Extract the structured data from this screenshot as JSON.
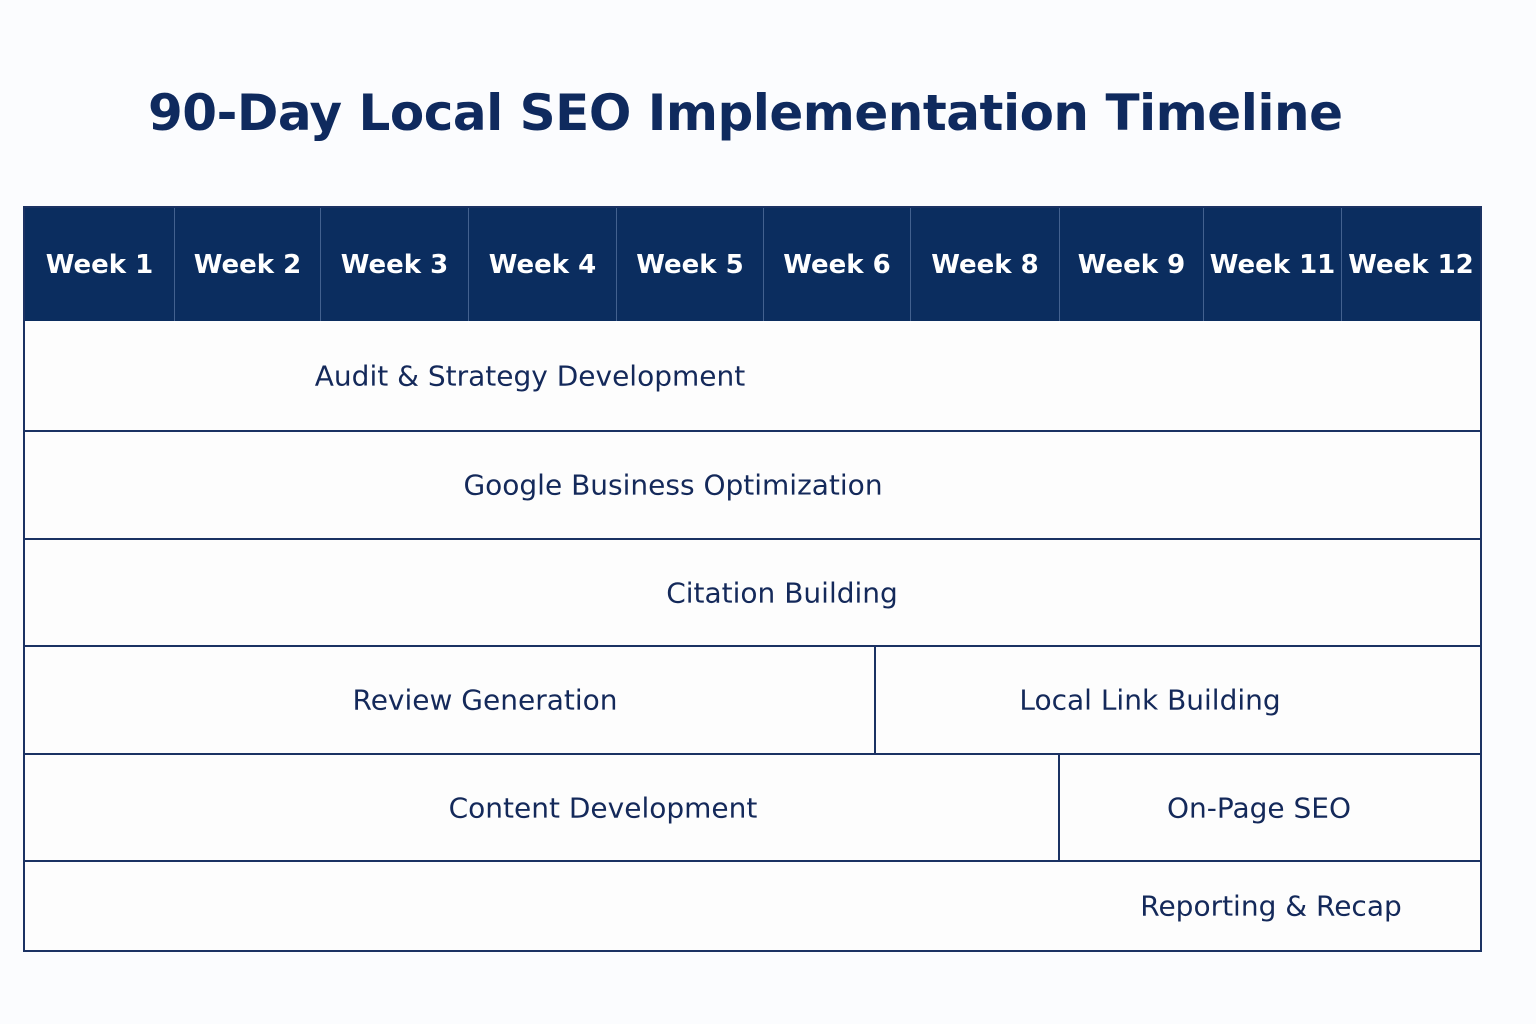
{
  "title": "90-Day Local SEO Implementation Timeline",
  "weeks": [
    "Week 1",
    "Week 2",
    "Week 3",
    "Week 4",
    "Week 5",
    "Week 6",
    "Week 8",
    "Week 9",
    "Week 11",
    "Week 12"
  ],
  "tasks": {
    "audit": "Audit & Strategy Development",
    "gbp": "Google Business Optimization",
    "citation": "Citation Building",
    "review": "Review Generation",
    "link": "Local Link Building",
    "content": "Content Development",
    "onpage": "On-Page SEO",
    "reporting": "Reporting & Recap"
  },
  "colors": {
    "header_bg": "#0b2d5f",
    "title": "#0f2a5e",
    "border": "#1b3263",
    "text": "#14295a"
  }
}
